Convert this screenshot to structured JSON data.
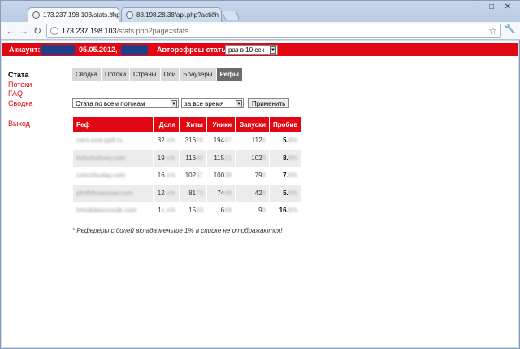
{
  "browser": {
    "tabs": [
      {
        "title": "173.237.198.103/stats.php?p",
        "active": true
      },
      {
        "title": "88.198.28.38/api.php?action",
        "active": false
      }
    ],
    "url_host": "173.237.198.103",
    "url_path": "/stats.php?page=stats",
    "window_controls": [
      "–",
      "□",
      "✕"
    ]
  },
  "topbar": {
    "account_label": "Аккаунт:",
    "date": "05.05.2012,",
    "autorefresh_label": "Авторефреш статы:",
    "autorefresh_value": "раз в 10 сек"
  },
  "sidenav": [
    {
      "label": "Стата",
      "current": true
    },
    {
      "label": "Потоки",
      "current": false
    },
    {
      "label": "FAQ",
      "current": false
    },
    {
      "label": "Сводка",
      "current": false
    },
    {
      "label": "Выход",
      "current": false
    }
  ],
  "page_tabs": [
    {
      "label": "Сводка",
      "active": false
    },
    {
      "label": "Потоки",
      "active": false
    },
    {
      "label": "Страны",
      "active": false
    },
    {
      "label": "Оси",
      "active": false
    },
    {
      "label": "Браузеры",
      "active": false
    },
    {
      "label": "Рефы",
      "active": true
    }
  ],
  "filters": {
    "stream_select": "Стата по всем потокам",
    "period_select": "за все время",
    "apply_button": "Применить"
  },
  "table": {
    "headers": [
      "Реф",
      "Доля",
      "Хиты",
      "Уники",
      "Запуски",
      "Пробив"
    ],
    "rows": [
      {
        "ref": "cars-xxxt-ppif.ru",
        "share": "32",
        "share_b": ".x%",
        "hits": "316",
        "hits_b": "78",
        "uniq": "194",
        "uniq_b": "47",
        "launch": "112",
        "launch_b": "6",
        "pen": "5.",
        "pen_b": "8%"
      },
      {
        "ref": "hxfcvhxhxey.com",
        "share": "19",
        "share_b": ".x%",
        "hits": "116",
        "hits_b": "40",
        "uniq": "115",
        "uniq_b": "21",
        "launch": "102",
        "launch_b": "8",
        "pen": "8.",
        "pen_b": "8%"
      },
      {
        "ref": "xxhcxfxvday.com",
        "share": "16",
        "share_b": ".x%",
        "hits": "102",
        "hits_b": "37",
        "uniq": "100",
        "uniq_b": "38",
        "launch": "79",
        "launch_b": "8",
        "pen": "7.",
        "pen_b": "8%"
      },
      {
        "ref": "jdmfhfxxasxwe.com",
        "share": "12",
        "share_b": ".x%",
        "hits": "81",
        "hits_b": "73",
        "uniq": "74",
        "uniq_b": "48",
        "launch": "42",
        "launch_b": "8",
        "pen": "5.",
        "pen_b": "8%"
      },
      {
        "ref": "hhhdtdwxxxxotk.com",
        "share": "1",
        "share_b": "x.x%",
        "hits": "15",
        "hits_b": "33",
        "uniq": "6",
        "uniq_b": "48",
        "launch": "9",
        "launch_b": "8",
        "pen": "16.",
        "pen_b": "8%"
      }
    ]
  },
  "note": "* Рефереры с долей вклада меньше 1% в списке не отображаются!",
  "colors": {
    "accent": "#e30613",
    "redaction": "#1f3f8c",
    "active_tab": "#6b6b6b"
  }
}
